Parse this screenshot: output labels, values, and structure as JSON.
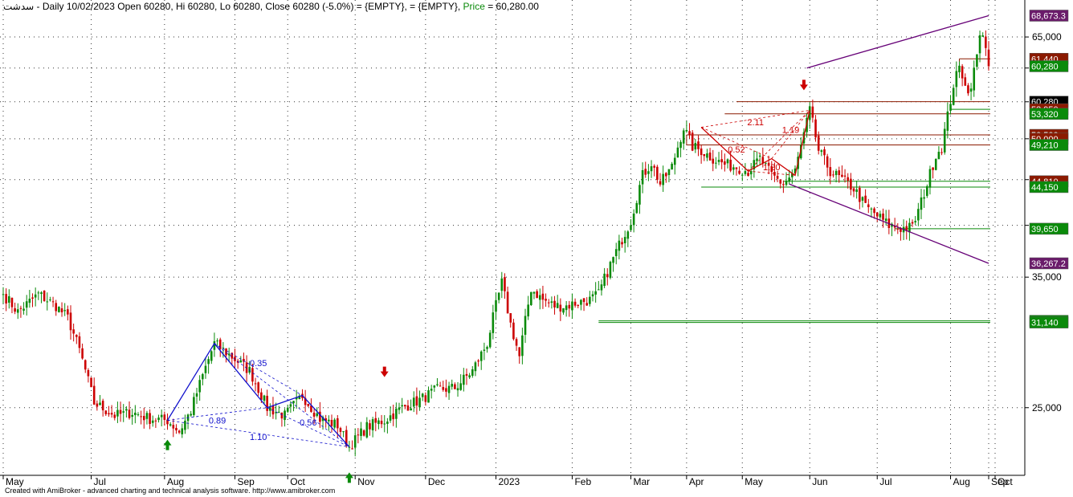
{
  "header": {
    "symbol": "سدشت",
    "info": " - Daily 10/02/2023 Open 60280, Hi 60280, Lo 60280, Close 60280 (-5.0%)   = {EMPTY},    = {EMPTY}, ",
    "price_label": "Price",
    "price_value": " = 60,280.00"
  },
  "footer": "Created with AmiBroker - advanced charting and technical analysis software. http://www.amibroker.com",
  "colors": {
    "up": "#0a8a0a",
    "down": "#cc0000",
    "pattern_blue": "#1010cc",
    "pattern_red": "#cc0000",
    "trend_purple": "#660077",
    "sr_brown": "#8b1a00",
    "sr_green": "#0a8a0a",
    "label_purple": "#6a1b6a",
    "label_black": "#000000"
  },
  "chart_data": {
    "type": "candlestick",
    "scale": "log",
    "ylim": [
      21000,
      71500
    ],
    "y_ticks": [
      25000,
      35000,
      40000,
      45000,
      50000,
      55000,
      60000,
      65000
    ],
    "y_tick_labels": [
      "25,000",
      "35,000",
      "",
      "",
      "",
      "",
      "",
      "65,000"
    ],
    "x_labels": [
      "May",
      "Jul",
      "Aug",
      "Sep",
      "Oct",
      "Nov",
      "Dec",
      "2023",
      "Feb",
      "Mar",
      "Apr",
      "May",
      "Jun",
      "Jul",
      "Aug",
      "Sep",
      "Oct"
    ],
    "last_bar": {
      "date": "10/02/2023",
      "open": 60280,
      "high": 60280,
      "low": 60280,
      "close": 60280,
      "change_pct": -5.0
    },
    "price_path": [
      [
        0,
        33500
      ],
      [
        5,
        32000
      ],
      [
        12,
        33500
      ],
      [
        18,
        32500
      ],
      [
        22,
        31500
      ],
      [
        26,
        29000
      ],
      [
        31,
        25300
      ],
      [
        38,
        24500
      ],
      [
        44,
        24700
      ],
      [
        50,
        24300
      ],
      [
        56,
        24200
      ],
      [
        60,
        23500
      ],
      [
        64,
        24800
      ],
      [
        72,
        29500
      ],
      [
        78,
        28500
      ],
      [
        84,
        27500
      ],
      [
        90,
        25000
      ],
      [
        96,
        24500
      ],
      [
        102,
        25800
      ],
      [
        108,
        24300
      ],
      [
        114,
        23900
      ],
      [
        118,
        22600
      ],
      [
        124,
        23800
      ],
      [
        130,
        24200
      ],
      [
        136,
        25000
      ],
      [
        142,
        25500
      ],
      [
        148,
        26200
      ],
      [
        154,
        26300
      ],
      [
        160,
        27500
      ],
      [
        165,
        29500
      ],
      [
        168,
        32500
      ],
      [
        170,
        34500
      ],
      [
        173,
        31000
      ],
      [
        176,
        28500
      ],
      [
        180,
        34000
      ],
      [
        184,
        33000
      ],
      [
        188,
        32500
      ],
      [
        192,
        32500
      ],
      [
        196,
        32800
      ],
      [
        200,
        33000
      ],
      [
        203,
        33500
      ],
      [
        206,
        35500
      ],
      [
        210,
        38000
      ],
      [
        214,
        40500
      ],
      [
        218,
        45500
      ],
      [
        221,
        47000
      ],
      [
        224,
        44500
      ],
      [
        228,
        46500
      ],
      [
        232,
        51500
      ],
      [
        235,
        49000
      ],
      [
        238,
        48500
      ],
      [
        242,
        47500
      ],
      [
        246,
        46800
      ],
      [
        250,
        46500
      ],
      [
        254,
        46000
      ],
      [
        258,
        47500
      ],
      [
        262,
        45500
      ],
      [
        266,
        44500
      ],
      [
        270,
        46000
      ],
      [
        273,
        50500
      ],
      [
        275,
        53800
      ],
      [
        278,
        48500
      ],
      [
        282,
        46000
      ],
      [
        286,
        45000
      ],
      [
        290,
        44000
      ],
      [
        294,
        42000
      ],
      [
        298,
        41000
      ],
      [
        302,
        40000
      ],
      [
        306,
        39700
      ],
      [
        310,
        39800
      ],
      [
        312,
        41500
      ],
      [
        315,
        44500
      ],
      [
        318,
        48000
      ],
      [
        320,
        49000
      ],
      [
        322,
        53000
      ],
      [
        324,
        57500
      ],
      [
        326,
        60000
      ],
      [
        328,
        58000
      ],
      [
        329,
        56000
      ],
      [
        331,
        59500
      ],
      [
        332,
        62000
      ],
      [
        333,
        64800
      ],
      [
        334,
        66000
      ],
      [
        335,
        63500
      ],
      [
        336,
        60280
      ]
    ],
    "support_resistance": {
      "levels": [
        68673.3,
        61440,
        60280,
        55010,
        53950,
        53320,
        50500,
        50000,
        49210,
        44810,
        44150,
        39650,
        36267.2,
        31270,
        31140
      ],
      "labels": [
        "68,673.3",
        "61,440",
        "60,280",
        "55,010",
        "53,950",
        "53,320",
        "50,500",
        "50,000",
        "49,210",
        "44,810",
        "44,150",
        "39,650",
        "36,267.2",
        "31,270",
        "31,140"
      ]
    },
    "harmonic_patterns": [
      {
        "color": "blue",
        "ratios": [
          "0.35",
          "0.89",
          "1.10",
          "0.56"
        ]
      },
      {
        "color": "red",
        "ratios": [
          "1.20",
          "0.52",
          "2.11",
          "1.19"
        ]
      }
    ],
    "trendlines": [
      {
        "from": [
          60000,
          "upper"
        ],
        "to": [
          68673.3,
          "end"
        ],
        "end_label": "68,673.3"
      },
      {
        "from": [
          44500,
          "lower"
        ],
        "to": [
          36267.2,
          "end"
        ],
        "end_label": "36,267.2"
      }
    ]
  }
}
